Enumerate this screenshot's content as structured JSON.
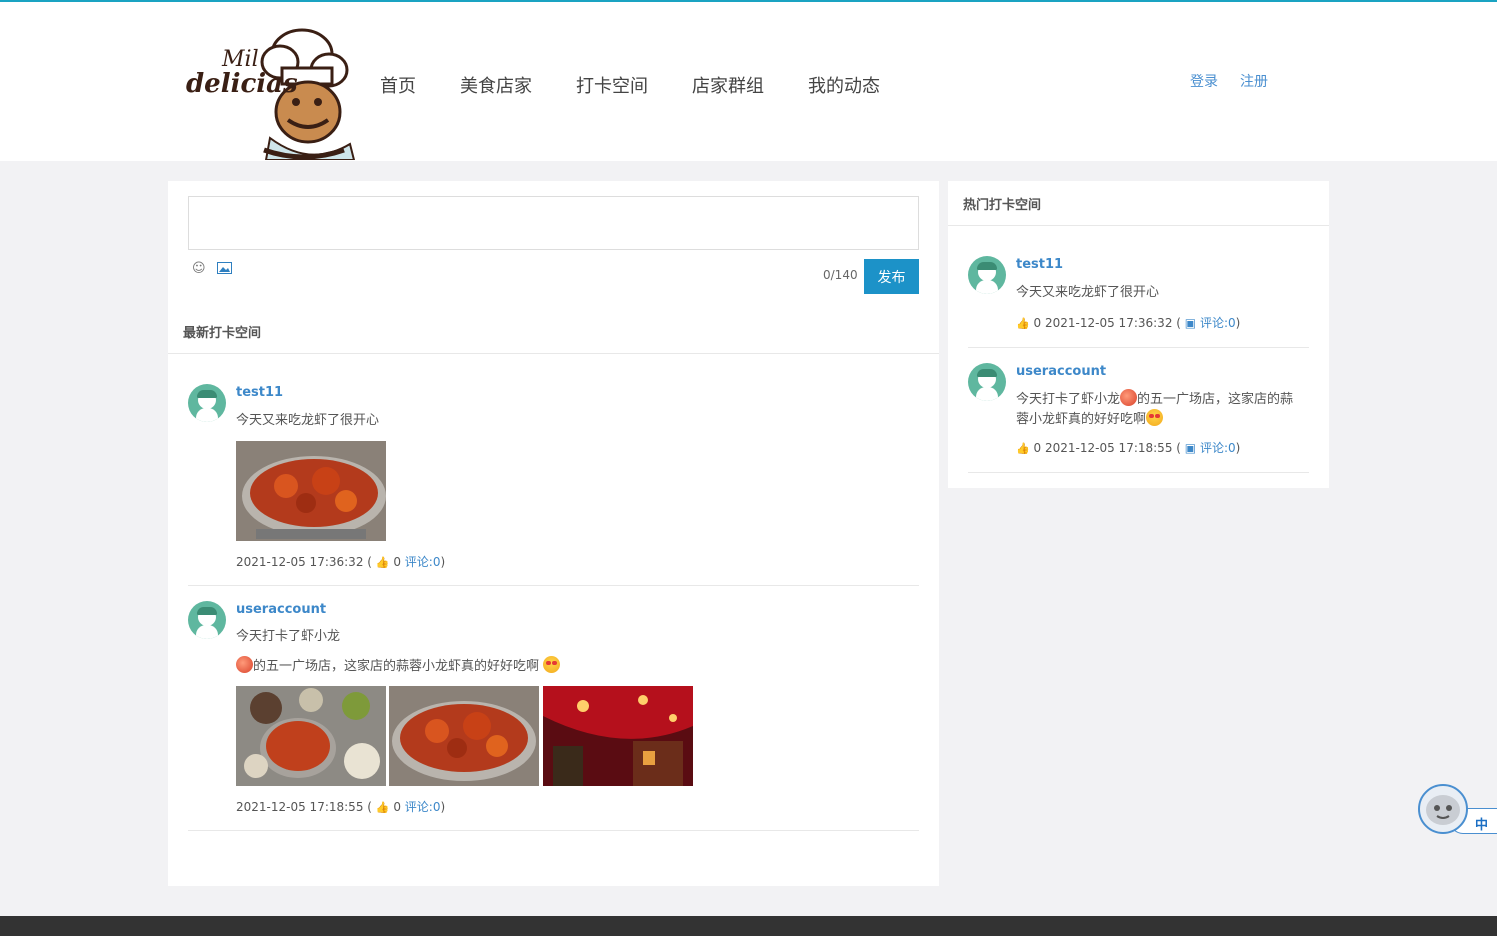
{
  "logo": {
    "line1": "Mil",
    "line2": "delicias"
  },
  "nav": [
    "首页",
    "美食店家",
    "打卡空间",
    "店家群组",
    "我的动态"
  ],
  "auth": {
    "login": "登录",
    "register": "注册"
  },
  "composer": {
    "placeholder": "",
    "counter": "0/140",
    "publish": "发布",
    "emoji_icon": "smiley-icon",
    "image_icon": "image-icon"
  },
  "feed": {
    "title": "最新打卡空间",
    "posts": [
      {
        "user": "test11",
        "text": "今天又来吃龙虾了很开心",
        "images": [
          "crawfish-pot"
        ],
        "time": "2021-12-05 17:36:32 (",
        "likes": "0",
        "comments": "评论:0",
        "close": ")"
      },
      {
        "user": "useraccount",
        "text": "今天打卡了虾小龙",
        "text2": "的五一广场店，这家店的蒜蓉小龙虾真的好好吃啊",
        "images": [
          "crawfish-table",
          "crawfish-pot",
          "restaurant-interior"
        ],
        "time": "2021-12-05 17:18:55 (",
        "likes": "0",
        "comments": "评论:0",
        "close": ")"
      }
    ]
  },
  "hot": {
    "title": "热门打卡空间",
    "posts": [
      {
        "user": "test11",
        "text": "今天又来吃龙虾了很开心",
        "likes": "0",
        "time": "2021-12-05 17:36:32 (",
        "comments": "评论:0",
        "close": ")"
      },
      {
        "user": "useraccount",
        "text_a": "今天打卡了虾小龙",
        "text_b": "的五一广场店，这家店的蒜",
        "text_c": "蓉小龙虾真的好好吃啊",
        "likes": "0",
        "time": "2021-12-05 17:18:55 (",
        "comments": "评论:0",
        "close": ")"
      }
    ]
  },
  "widget": {
    "label": "中"
  },
  "colors": {
    "accent": "#1c92c8",
    "link": "#3d88c9",
    "avatar": "#5fb79f"
  }
}
